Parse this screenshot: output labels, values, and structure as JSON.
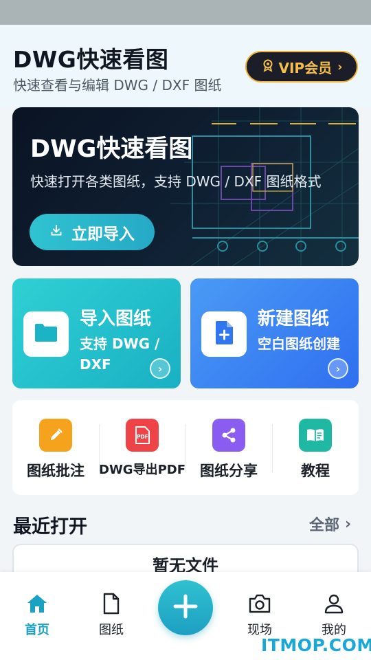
{
  "header": {
    "title": "DWG快速看图",
    "subtitle": "快速查看与编辑 DWG / DXF 图纸",
    "vip_label": "VIP会员",
    "vip_chevron": "›"
  },
  "hero": {
    "title": "DWG快速看图",
    "subtitle": "快速打开各类图纸，支持 DWG / DXF 图纸格式",
    "button_label": "立即导入",
    "button_icon": "download-icon"
  },
  "cards": [
    {
      "title": "导入图纸",
      "subtitle": "支持 DWG / DXF",
      "icon": "folder-icon",
      "arrow": "›"
    },
    {
      "title": "新建图纸",
      "subtitle": "空白图纸创建",
      "icon": "new-file-icon",
      "arrow": "›"
    }
  ],
  "tools": [
    {
      "label": "图纸批注",
      "icon": "pencil-icon",
      "color": "#f5a21c"
    },
    {
      "label": "DWG导出PDF",
      "icon": "pdf-icon",
      "color": "#ef4447"
    },
    {
      "label": "图纸分享",
      "icon": "share-icon",
      "color": "#8b5cf0"
    },
    {
      "label": "教程",
      "icon": "book-icon",
      "color": "#1fb8a2"
    }
  ],
  "recent": {
    "title": "最近打开",
    "all_label": "全部",
    "all_chevron": "›",
    "empty_text": "暂无文件"
  },
  "bottom_nav": [
    {
      "label": "首页",
      "icon": "home-icon",
      "active": true
    },
    {
      "label": "图纸",
      "icon": "document-icon",
      "active": false
    },
    {
      "label": "现场",
      "icon": "camera-icon",
      "active": false
    },
    {
      "label": "我的",
      "icon": "user-icon",
      "active": false
    }
  ],
  "fab": {
    "icon": "plus-icon"
  },
  "watermark": "ITMOP.COM",
  "colors": {
    "accent": "#1aa2c2",
    "vip_gold": "#f0b23b",
    "hero_bg": "#0f2033"
  }
}
